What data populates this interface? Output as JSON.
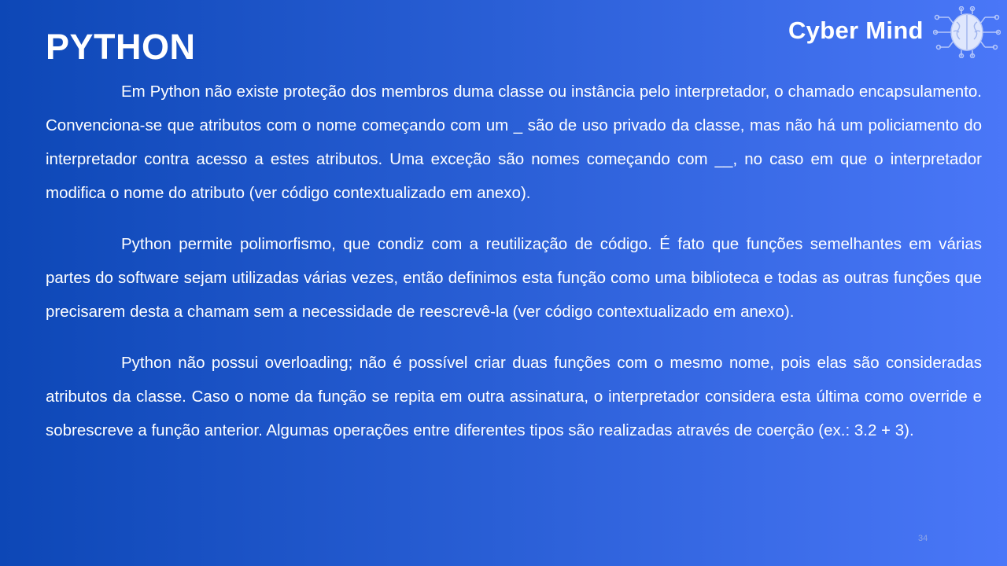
{
  "slide": {
    "title": "PYTHON",
    "logo_text": "Cyber Mind",
    "logo_icon": "brain-circuit-icon",
    "paragraphs": [
      "Em Python não existe proteção dos membros duma classe ou instância pelo interpretador, o chamado encapsulamento. Convenciona-se que atributos com o nome começando com um _ são de uso privado da classe, mas não há um policiamento do interpretador contra acesso a estes atributos. Uma exceção são nomes começando com __, no caso em que o interpretador modifica o nome do atributo (ver código contextualizado em anexo).",
      "Python permite polimorfismo, que condiz com a reutilização de código. É fato que funções semelhantes em várias partes do software sejam utilizadas várias vezes, então definimos esta função como uma biblioteca e todas as outras funções que precisarem desta a chamam sem a necessidade de reescrevê-la (ver código contextualizado em anexo).",
      "Python não possui overloading; não é possível criar duas funções com o mesmo nome, pois elas são consideradas atributos da classe. Caso o nome da função se repita em outra assinatura, o interpretador considera esta última como override e sobrescreve a função anterior. Algumas operações entre diferentes tipos são realizadas através de coerção (ex.: 3.2 + 3)."
    ],
    "page_number": "34"
  },
  "colors": {
    "background_left": "#0d47b6",
    "background_right": "#4a77f8",
    "text": "#ffffff"
  }
}
